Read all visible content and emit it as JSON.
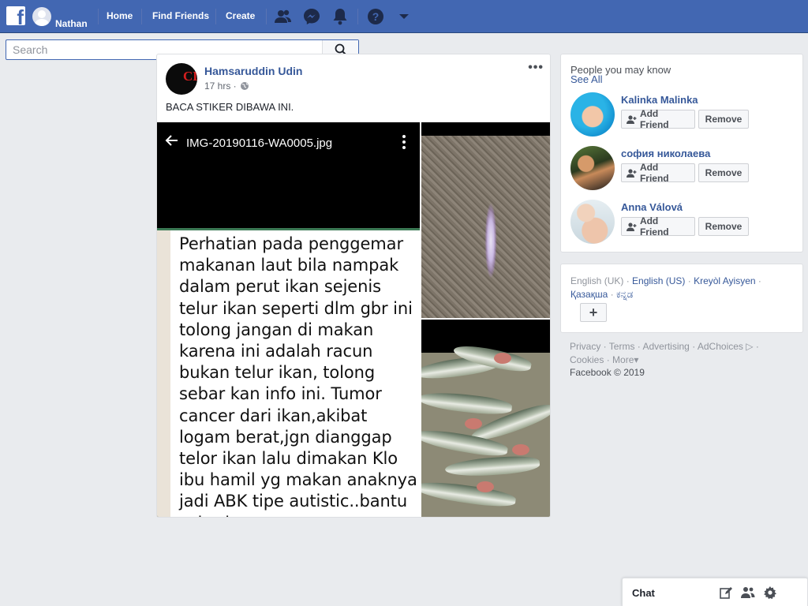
{
  "topbar": {
    "user_name": "Nathan",
    "nav": [
      "Home",
      "Find Friends",
      "Create"
    ],
    "icons": [
      "friend-requests-icon",
      "messenger-icon",
      "notifications-icon",
      "help-icon",
      "account-menu-icon"
    ],
    "brand_color": "#4267b2"
  },
  "search": {
    "placeholder": "Search"
  },
  "post": {
    "author": "Hamsaruddin Udin",
    "time": "17 hrs ·",
    "text": "BACA STIKER DIBAWA INI.",
    "image": {
      "file_name": "IMG-20190116-WA0005.jpg",
      "message": "Perhatian pada penggemar makanan laut bila nampak dalam perut ikan sejenis telur ikan seperti dlm gbr ini tolong jangan di makan karena ini adalah racun bukan telur ikan, tolong sebar kan info ini. Tumor cancer dari ikan,akibat logam berat,jgn dianggap telor ikan lalu dimakan Klo ibu hamil yg makan anaknya jadi ABK tipe autistic..bantu sebarkan...."
    }
  },
  "pymk": {
    "title": "People you may know",
    "see_all": "See All",
    "people": [
      {
        "name": "Kalinka Malinka",
        "add": "Add Friend",
        "remove": "Remove"
      },
      {
        "name": "софия николаева",
        "add": "Add Friend",
        "remove": "Remove"
      },
      {
        "name": "Anna Válová",
        "add": "Add Friend",
        "remove": "Remove"
      }
    ]
  },
  "languages": {
    "current": "English (UK)",
    "options": [
      "English (US)",
      "Kreyòl Ayisyen",
      "Қазақша",
      "ಕನ್ನಡ"
    ],
    "add": "+"
  },
  "footer": {
    "links": [
      "Privacy",
      "Terms",
      "Advertising",
      "AdChoices",
      "Cookies",
      "More"
    ],
    "copyright": "Facebook © 2019"
  },
  "chat": {
    "label": "Chat"
  }
}
